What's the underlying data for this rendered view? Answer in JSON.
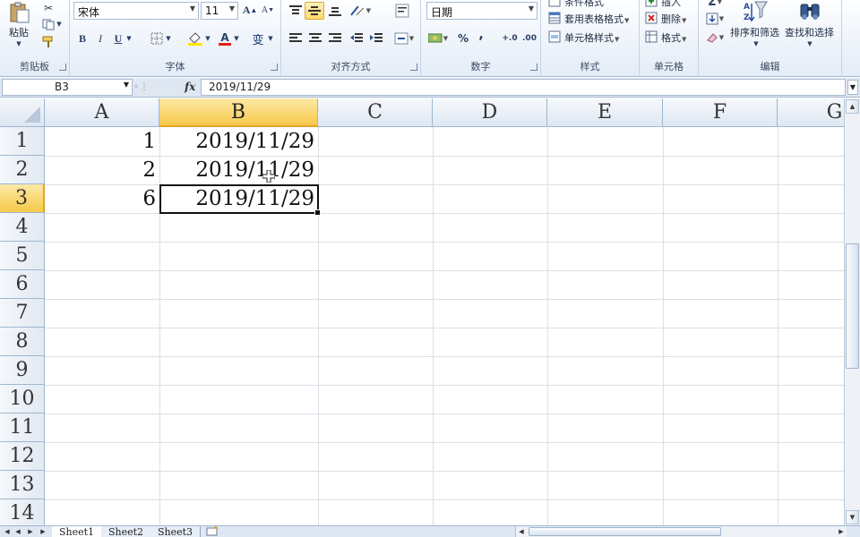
{
  "ribbon": {
    "clipboard": {
      "paste_label": "粘贴",
      "group_label": "剪贴板"
    },
    "font": {
      "font_name": "宋体",
      "font_size": "11",
      "bold": "B",
      "italic": "I",
      "underline": "U",
      "grow": "A",
      "shrink": "A",
      "font_color": "A",
      "phonetic": "变",
      "group_label": "字体"
    },
    "alignment": {
      "group_label": "对齐方式"
    },
    "number": {
      "format": "日期",
      "percent": "%",
      "comma": ",",
      "inc_decimal": "+.0",
      "dec_decimal": ".00",
      "group_label": "数字"
    },
    "styles": {
      "conditional": "条件格式",
      "table_format": "套用表格格式",
      "cell_styles": "单元格样式",
      "group_label": "样式"
    },
    "cells": {
      "insert": "插入",
      "delete": "删除",
      "format": "格式",
      "group_label": "单元格"
    },
    "editing": {
      "sigma": "Σ",
      "sort_filter": "排序和筛选",
      "find_select": "查找和选择",
      "group_label": "编辑"
    }
  },
  "formula_bar": {
    "name_box": "B3",
    "fx": "fx",
    "formula": "2019/11/29"
  },
  "grid": {
    "columns": [
      "A",
      "B",
      "C",
      "D",
      "E",
      "F",
      "G"
    ],
    "rows": [
      "1",
      "2",
      "3",
      "4",
      "5",
      "6",
      "7",
      "8",
      "9",
      "10",
      "11",
      "12",
      "13",
      "14"
    ],
    "cells": {
      "A1": "1",
      "B1": "2019/11/29",
      "A2": "2",
      "B2": "2019/11/29",
      "A3": "6",
      "B3": "2019/11/29"
    },
    "selected_cell": "B3"
  },
  "sheets": [
    "Sheet1",
    "Sheet2",
    "Sheet3"
  ],
  "active_sheet": "Sheet1",
  "colors": {
    "selection_header": "#f6c94a",
    "ribbon_bg": "#e4ecf7",
    "grid_line": "#dadfe6"
  }
}
